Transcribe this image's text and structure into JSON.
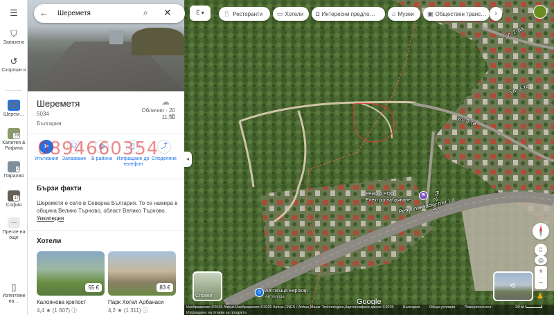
{
  "rail": {
    "menu_icon": "menu-icon",
    "items": [
      {
        "label": "Запазено",
        "icon": "bookmark-icon"
      },
      {
        "label": "Скорошн и",
        "icon": "history-icon"
      },
      {
        "label": "Шерем…",
        "badge": ""
      },
      {
        "label": "Калитея & Рафина",
        "badge": "28"
      },
      {
        "label": "Паралия",
        "badge": "2"
      },
      {
        "label": "София",
        "badge": "17"
      },
      {
        "label": "Прегле на още",
        "icon": "more-icon"
      },
      {
        "label": "Изтегляне на…",
        "icon": "phone-icon"
      }
    ]
  },
  "search": {
    "query": "Шереметя"
  },
  "place": {
    "title": "Шереметя",
    "postcode": "5034",
    "country": "България",
    "weather": "Облачно · 20 °C",
    "time": "11:50"
  },
  "actions": [
    {
      "label": "Упътвания",
      "icon": "directions-icon"
    },
    {
      "label": "Запазване",
      "icon": "bookmark-icon"
    },
    {
      "label": "В района",
      "icon": "nearby-icon"
    },
    {
      "label": "Изпращане до телефон",
      "icon": "send-to-phone-icon"
    },
    {
      "label": "Споделяне",
      "icon": "share-icon"
    }
  ],
  "watermark": "0894660354",
  "facts": {
    "title": "Бързи факти",
    "text": "Шереметя е село в Северна България. То се намира в община Велико Търново, област Велико Търново.",
    "link": "Уикипедия"
  },
  "hotels": {
    "title": "Хотели",
    "items": [
      {
        "name": "Калоянова крепост",
        "price": "55 €",
        "rating": "4,4 ★ (1 607) ⓘ"
      },
      {
        "name": "Парк Хотел Арбанаси",
        "price": "83 €",
        "rating": "4,2 ★ (1 311) ⓘ"
      }
    ]
  },
  "map": {
    "chips": [
      {
        "label": "Ресторанти",
        "icon": "restaurant-icon"
      },
      {
        "label": "Хотели",
        "icon": "hotel-icon"
      },
      {
        "label": "Интересни предло…",
        "icon": "camera-icon"
      },
      {
        "label": "Музеи",
        "icon": "museum-icon"
      },
      {
        "label": "Обществен транс…",
        "icon": "transit-icon"
      }
    ],
    "road_labels": [
      "ул. 2-ра",
      "ул. 3-та",
      "ул. 3-та",
      "Републикански път I-4",
      "ул. 3-та"
    ],
    "pois": [
      "Ремонт РОО-Електроснабдяване",
      "Автокъща Еврокар",
      "Автокъща"
    ],
    "layers_label": "Слоеве",
    "google": "Google",
    "attribution": "Изображения ©2025 Airbus,Изображения ©2025 Airbus,CNES / Airbus,Maxar Technologies,Картографски данни ©2025",
    "attribution2": "Изпращане на отзиви за продукта",
    "links": [
      "България",
      "Общи условия",
      "Поверителност"
    ],
    "scale": "20 м"
  }
}
